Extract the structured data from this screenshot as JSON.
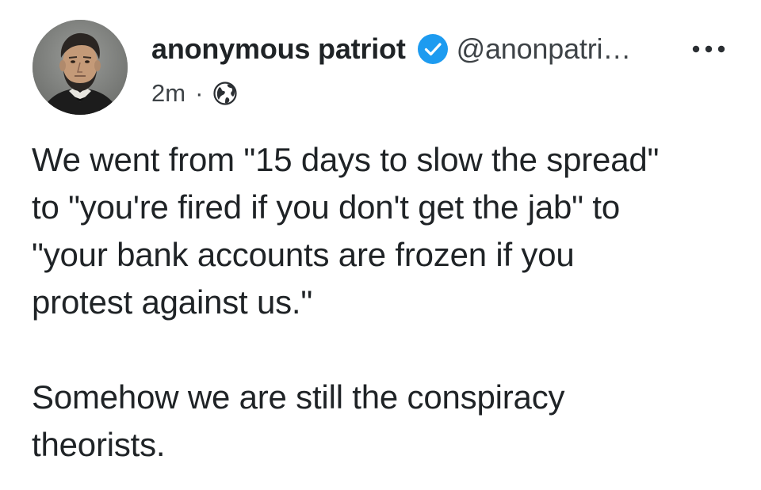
{
  "post": {
    "author": {
      "display_name": "anonymous patriot",
      "handle": "@anonpatri…",
      "verified": true,
      "avatar_icon": "portrait-avatar"
    },
    "meta": {
      "timestamp": "2m",
      "separator": "·",
      "visibility_icon": "globe-icon"
    },
    "more_icon": "ellipsis-icon",
    "body": {
      "paragraph_1": "We went from \"15 days to slow the spread\"\nto \"you're fired if you don't get the jab\" to\n\"your bank accounts are frozen if you\nprotest against us.\"",
      "paragraph_2": "Somehow we are still the conspiracy\ntheorists."
    }
  },
  "colors": {
    "text": "#1f2326",
    "secondary_text": "#3e4347",
    "verified_badge": "#1d9bf0",
    "background": "#ffffff"
  }
}
